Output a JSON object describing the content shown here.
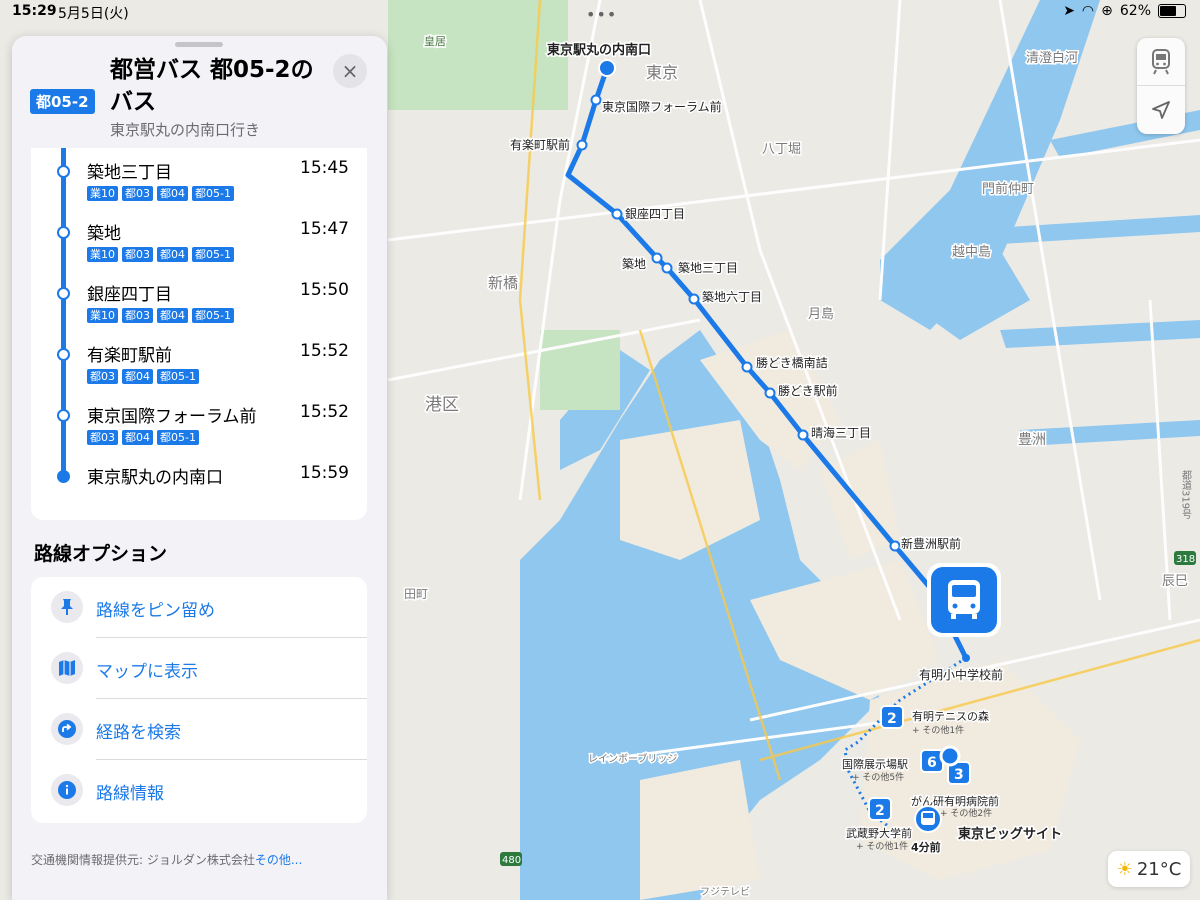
{
  "status_bar": {
    "time": "15:29",
    "date": "5月5日(火)",
    "battery": "62%"
  },
  "panel": {
    "route_badge": "都05-2",
    "title": "都営バス 都05-2のバス",
    "subtitle": "東京駅丸の内南口行き",
    "close_label": "×",
    "stops": [
      {
        "name": "築地三丁目",
        "time": "15:45",
        "tags": [
          "業10",
          "都03",
          "都04",
          "都05-1"
        ]
      },
      {
        "name": "築地",
        "time": "15:47",
        "tags": [
          "業10",
          "都03",
          "都04",
          "都05-1"
        ]
      },
      {
        "name": "銀座四丁目",
        "time": "15:50",
        "tags": [
          "業10",
          "都03",
          "都04",
          "都05-1"
        ]
      },
      {
        "name": "有楽町駅前",
        "time": "15:52",
        "tags": [
          "都03",
          "都04",
          "都05-1"
        ]
      },
      {
        "name": "東京国際フォーラム前",
        "time": "15:52",
        "tags": [
          "都03",
          "都04",
          "都05-1"
        ]
      },
      {
        "name": "東京駅丸の内南口",
        "time": "15:59",
        "tags": []
      }
    ],
    "options_heading": "路線オプション",
    "options": [
      {
        "label": "路線をピン留め",
        "icon": "pin-icon"
      },
      {
        "label": "マップに表示",
        "icon": "map-icon"
      },
      {
        "label": "経路を検索",
        "icon": "directions-icon"
      },
      {
        "label": "路線情報",
        "icon": "info-icon"
      }
    ],
    "credit_text": "交通機関情報提供元: ジョルダン株式会社",
    "credit_more": "その他..."
  },
  "map": {
    "route_color": "#1c7ae8",
    "stop_labels": [
      "東京駅丸の内南口",
      "東京国際フォーラム前",
      "有楽町駅前",
      "銀座四丁目",
      "築地",
      "築地三丁目",
      "築地六丁目",
      "勝どき橋南詰",
      "勝どき駅前",
      "晴海三丁目",
      "新豊洲駅前",
      "有明小中学校前"
    ],
    "area_labels": [
      "皇居",
      "東京",
      "八丁堀",
      "門前仲町",
      "越中島",
      "清澄白河",
      "新橋",
      "月島",
      "港区",
      "豊洲",
      "辰巳",
      "田町",
      "レインボーブリッジ",
      "フジテレビ",
      "東京ビッグサイト"
    ],
    "cluster_labels": [
      {
        "count": "2",
        "name": "有明テニスの森",
        "more": "+ その他1件"
      },
      {
        "count": "6",
        "name": "国際展示場駅",
        "more": "+ その他5件"
      },
      {
        "count": "3",
        "name": "がん研有明病院前",
        "more": "+ その他2件"
      },
      {
        "count": "2",
        "name": "武蔵野大学前",
        "more": "+ その他1件"
      }
    ],
    "bus_eta": "4分前",
    "road_shields": [
      "318",
      "480"
    ],
    "vertical_road_label": "都道319号"
  },
  "weather": {
    "temperature": "21°C"
  }
}
